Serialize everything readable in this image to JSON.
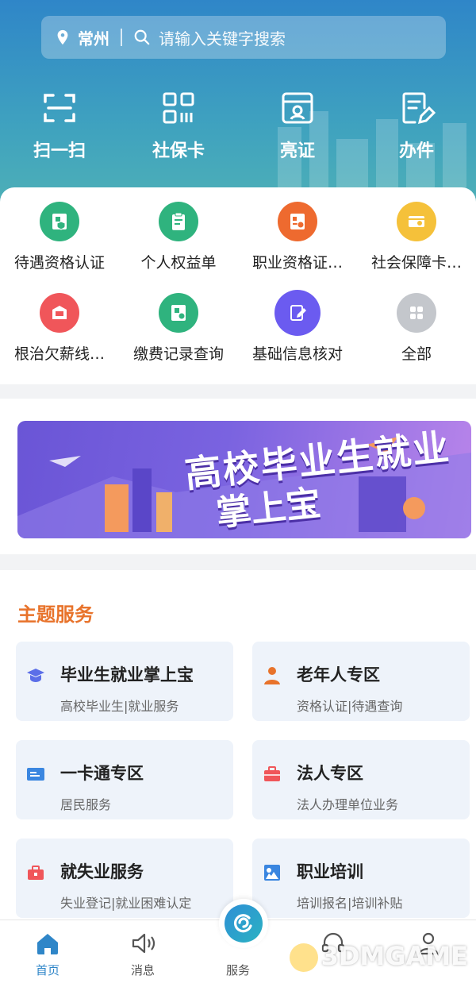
{
  "search": {
    "city": "常州",
    "placeholder": "请输入关键字搜索"
  },
  "quick_actions": [
    {
      "label": "扫一扫",
      "icon": "scan-icon"
    },
    {
      "label": "社保卡",
      "icon": "qr-card-icon"
    },
    {
      "label": "亮证",
      "icon": "id-badge-icon"
    },
    {
      "label": "办件",
      "icon": "edit-document-icon"
    }
  ],
  "services": [
    {
      "label": "待遇资格认证",
      "icon": "shield-card-icon",
      "color": "#2fb37e"
    },
    {
      "label": "个人权益单",
      "icon": "clipboard-icon",
      "color": "#2fb37e"
    },
    {
      "label": "职业资格证…",
      "icon": "certificate-icon",
      "color": "#ee6a2f"
    },
    {
      "label": "社会保障卡…",
      "icon": "card-icon",
      "color": "#f5c13a"
    },
    {
      "label": "根治欠薪线…",
      "icon": "wallet-icon",
      "color": "#f0565a"
    },
    {
      "label": "缴费记录查询",
      "icon": "record-icon",
      "color": "#2fb37e"
    },
    {
      "label": "基础信息核对",
      "icon": "edit-icon",
      "color": "#6b5bf0"
    },
    {
      "label": "全部",
      "icon": "grid-icon",
      "color": "#c4c7cc"
    }
  ],
  "banner": {
    "line1": "高校毕业生就业",
    "line2": "掌上宝"
  },
  "theme": {
    "title": "主题服务",
    "cards": [
      {
        "title": "毕业生就业掌上宝",
        "subtitle": "高校毕业生|就业服务",
        "icon": "graduation-cap-icon",
        "color": "#5b6ee8"
      },
      {
        "title": "老年人专区",
        "subtitle": "资格认证|待遇查询",
        "icon": "elder-icon",
        "color": "#e8732b"
      },
      {
        "title": "一卡通专区",
        "subtitle": "居民服务",
        "icon": "id-card-icon",
        "color": "#3a86e0"
      },
      {
        "title": "法人专区",
        "subtitle": "法人办理单位业务",
        "icon": "briefcase-icon",
        "color": "#f0565a"
      },
      {
        "title": "就失业服务",
        "subtitle": "失业登记|就业困难认定",
        "icon": "toolbox-icon",
        "color": "#f0565a"
      },
      {
        "title": "职业培训",
        "subtitle": "培训报名|培训补贴",
        "icon": "training-icon",
        "color": "#3a86e0"
      }
    ]
  },
  "tabbar": {
    "tabs": [
      {
        "label": "首页",
        "icon": "home-icon",
        "active": true
      },
      {
        "label": "消息",
        "icon": "speaker-icon",
        "active": false
      },
      {
        "label": "服务",
        "icon": "service-logo-icon",
        "active": false
      },
      {
        "label": "",
        "icon": "headset-icon",
        "active": false
      },
      {
        "label": "",
        "icon": "user-icon",
        "active": false
      }
    ]
  },
  "watermark": "3DMGAME",
  "colors": {
    "primary": "#2f86c8",
    "theme_title": "#e8732b"
  }
}
